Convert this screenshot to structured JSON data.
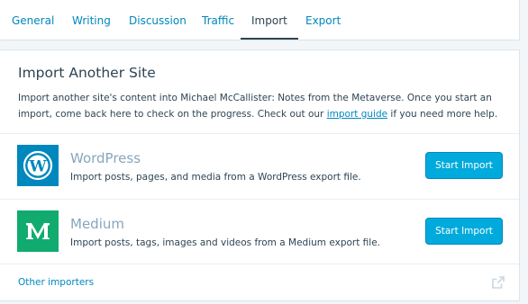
{
  "tabs": [
    {
      "label": "General"
    },
    {
      "label": "Writing"
    },
    {
      "label": "Discussion"
    },
    {
      "label": "Traffic"
    },
    {
      "label": "Import",
      "selected": true
    },
    {
      "label": "Export"
    }
  ],
  "card": {
    "title": "Import Another Site",
    "desc_line1": "Import another site's content into Michael McCallister: Notes from the Metaverse. Once you start an",
    "desc_line2_before": "import, come back here to check on the progress. Check out our ",
    "desc_link": "import guide",
    "desc_line2_after": " if you need more help."
  },
  "importers": [
    {
      "name": "WordPress",
      "description": "Import posts, pages, and media from a WordPress export file.",
      "button_label": "Start Import",
      "logo_icon": "wordpress-logo-icon",
      "logo_color": "#0087be"
    },
    {
      "name": "Medium",
      "description": "Import posts, tags, images and videos from a Medium export file.",
      "button_label": "Start Import",
      "logo_icon": "medium-logo-icon",
      "logo_color": "#12ab6f"
    }
  ],
  "footer": {
    "other_importers_label": "Other importers",
    "icon": "external-link-icon"
  },
  "colors": {
    "link": "#0087be",
    "text": "#2e4453",
    "muted": "#87a6bc",
    "primary_button": "#00aadc"
  }
}
